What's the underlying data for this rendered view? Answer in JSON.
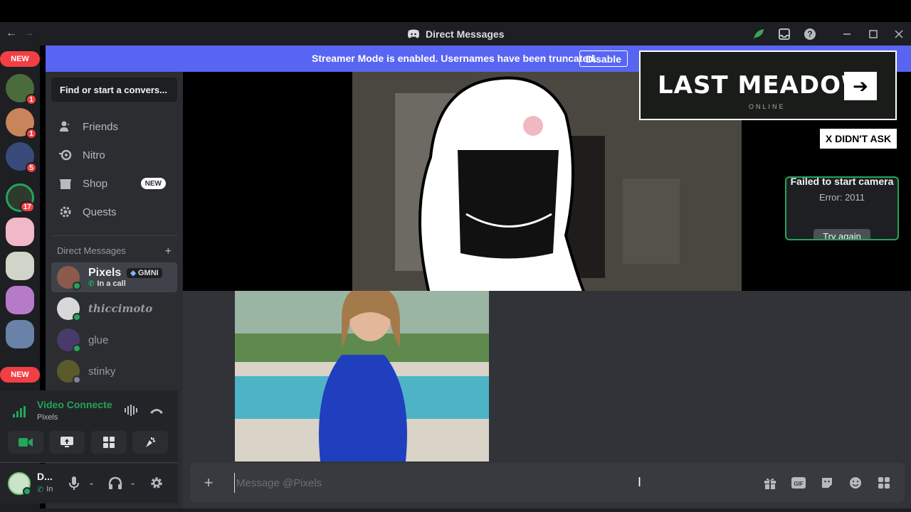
{
  "window": {
    "title": "Direct Messages",
    "back_glyph": "←",
    "forward_glyph": "→"
  },
  "banner": {
    "text": "Streamer Mode is enabled. Usernames have been truncated.",
    "button": "Disable"
  },
  "servers": {
    "new_top": "NEW",
    "new_bottom": "NEW",
    "badges": [
      "1",
      "1",
      "5",
      "17"
    ]
  },
  "sidebar": {
    "search_placeholder": "Find or start a convers...",
    "nav": [
      {
        "label": "Friends",
        "icon": "friends-icon"
      },
      {
        "label": "Nitro",
        "icon": "nitro-icon"
      },
      {
        "label": "Shop",
        "icon": "shop-icon",
        "badge": "NEW"
      },
      {
        "label": "Quests",
        "icon": "quests-icon"
      }
    ],
    "dm_header": "Direct Messages",
    "dms": [
      {
        "name": "Pixels",
        "tag": "GMNI",
        "status": "In a call"
      },
      {
        "name": "thiccimoto"
      },
      {
        "name": "glue"
      },
      {
        "name": "stinky"
      }
    ]
  },
  "voice": {
    "title": "Video Connecte",
    "subtitle": "Pixels"
  },
  "user": {
    "name": "D...",
    "status": "In"
  },
  "stream": {
    "logo_text": "LAST MEADOW",
    "logo_sub": "ONLINE",
    "sticker": "X DIDN'T ASK",
    "camera_error_title": "Failed to start camera",
    "camera_error_code": "Error: 2011",
    "camera_retry": "Try again"
  },
  "composer": {
    "placeholder": "Message @Pixels",
    "value": ""
  },
  "colors": {
    "blurple": "#5865f2",
    "green": "#23a55a",
    "red": "#f23f43"
  }
}
